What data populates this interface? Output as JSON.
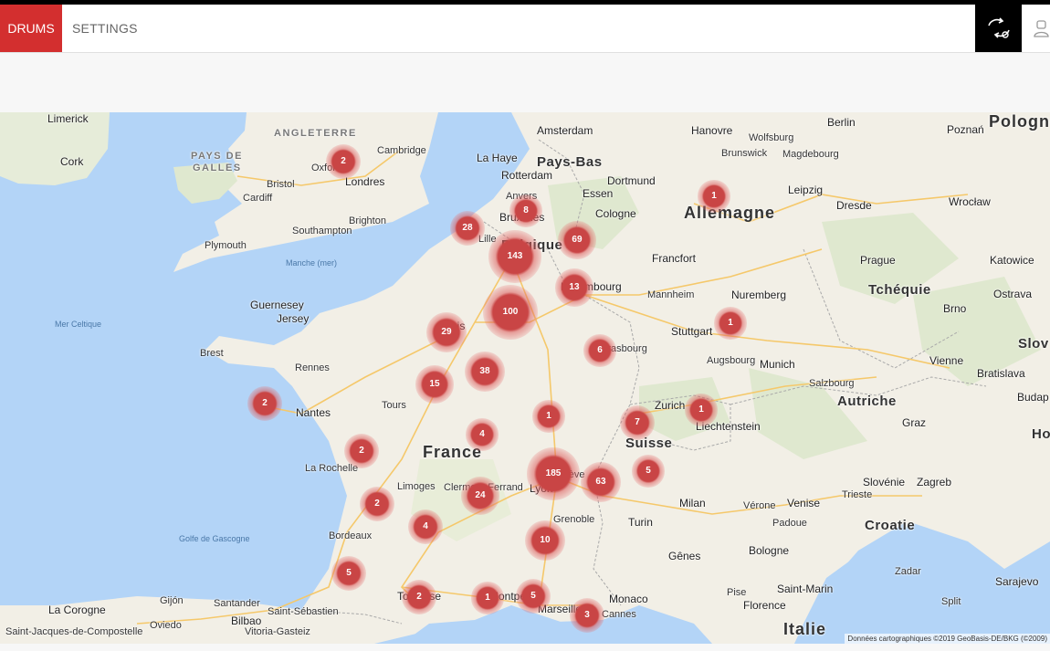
{
  "nav": {
    "drums_label": "DRUMS",
    "settings_label": "SETTINGS",
    "sync_icon": "sync-icon",
    "user_icon": "user-icon"
  },
  "colors": {
    "accent": "#d32f2f",
    "marker": "#c94545",
    "water": "#b3d4f7",
    "land": "#f2efe6"
  },
  "map": {
    "attribution": "Données cartographiques ©2019 GeoBasis-DE/BKG (©2009)",
    "labels": [
      {
        "text": "Limerick",
        "cls": "city"
      },
      {
        "text": "ANGLETERRE",
        "cls": "region"
      },
      {
        "text": "PAYS DE",
        "cls": "region"
      },
      {
        "text": "GALLES",
        "cls": "region"
      },
      {
        "text": "Cork",
        "cls": "city"
      },
      {
        "text": "Cambridge",
        "cls": ""
      },
      {
        "text": "Oxford",
        "cls": ""
      },
      {
        "text": "Londres",
        "cls": "city"
      },
      {
        "text": "Bristol",
        "cls": ""
      },
      {
        "text": "Cardiff",
        "cls": ""
      },
      {
        "text": "Brighton",
        "cls": ""
      },
      {
        "text": "Southampton",
        "cls": ""
      },
      {
        "text": "Plymouth",
        "cls": ""
      },
      {
        "text": "Manche (mer)",
        "cls": "sea"
      },
      {
        "text": "Mer Celtique",
        "cls": "sea"
      },
      {
        "text": "Guernesey",
        "cls": "city"
      },
      {
        "text": "Jersey",
        "cls": "city"
      },
      {
        "text": "Brest",
        "cls": ""
      },
      {
        "text": "Rennes",
        "cls": ""
      },
      {
        "text": "Nantes",
        "cls": "city"
      },
      {
        "text": "Tours",
        "cls": ""
      },
      {
        "text": "La Rochelle",
        "cls": ""
      },
      {
        "text": "Limoges",
        "cls": ""
      },
      {
        "text": "Bordeaux",
        "cls": ""
      },
      {
        "text": "Golfe de Gascogne",
        "cls": "sea"
      },
      {
        "text": "France",
        "cls": "big"
      },
      {
        "text": "Amsterdam",
        "cls": "city"
      },
      {
        "text": "La Haye",
        "cls": "city"
      },
      {
        "text": "Pays-Bas",
        "cls": "med"
      },
      {
        "text": "Rotterdam",
        "cls": "city"
      },
      {
        "text": "Anvers",
        "cls": ""
      },
      {
        "text": "Bruxelles",
        "cls": "city"
      },
      {
        "text": "Lille",
        "cls": ""
      },
      {
        "text": "Belgique",
        "cls": "med"
      },
      {
        "text": "Luxembourg",
        "cls": "city"
      },
      {
        "text": "Paris",
        "cls": "city"
      },
      {
        "text": "Strasbourg",
        "cls": ""
      },
      {
        "text": "Hanovre",
        "cls": "city"
      },
      {
        "text": "Wolfsburg",
        "cls": ""
      },
      {
        "text": "Brunswick",
        "cls": ""
      },
      {
        "text": "Magdebourg",
        "cls": ""
      },
      {
        "text": "Berlin",
        "cls": "city"
      },
      {
        "text": "Poznań",
        "cls": "city"
      },
      {
        "text": "Pologne",
        "cls": "big"
      },
      {
        "text": "Dortmund",
        "cls": "city"
      },
      {
        "text": "Essen",
        "cls": "city"
      },
      {
        "text": "Cologne",
        "cls": "city"
      },
      {
        "text": "Leipzig",
        "cls": "city"
      },
      {
        "text": "Dresde",
        "cls": "city"
      },
      {
        "text": "Wrocław",
        "cls": "city"
      },
      {
        "text": "Allemagne",
        "cls": "big"
      },
      {
        "text": "Francfort",
        "cls": "city"
      },
      {
        "text": "Prague",
        "cls": "city"
      },
      {
        "text": "Katowice",
        "cls": "city"
      },
      {
        "text": "Mannheim",
        "cls": ""
      },
      {
        "text": "Nuremberg",
        "cls": "city"
      },
      {
        "text": "Tchéquie",
        "cls": "med"
      },
      {
        "text": "Ostrava",
        "cls": "city"
      },
      {
        "text": "Brno",
        "cls": "city"
      },
      {
        "text": "Stuttgart",
        "cls": "city"
      },
      {
        "text": "Augsbourg",
        "cls": ""
      },
      {
        "text": "Munich",
        "cls": "city"
      },
      {
        "text": "Salzbourg",
        "cls": ""
      },
      {
        "text": "Vienne",
        "cls": "city"
      },
      {
        "text": "Bratislava",
        "cls": "city"
      },
      {
        "text": "Slov",
        "cls": "med"
      },
      {
        "text": "Autriche",
        "cls": "med"
      },
      {
        "text": "Budap",
        "cls": "city"
      },
      {
        "text": "Zurich",
        "cls": "city"
      },
      {
        "text": "Liechtenstein",
        "cls": "city"
      },
      {
        "text": "Graz",
        "cls": "city"
      },
      {
        "text": "Suisse",
        "cls": "med"
      },
      {
        "text": "Genève",
        "cls": ""
      },
      {
        "text": "Lyon",
        "cls": "city"
      },
      {
        "text": "Clermont-Ferrand",
        "cls": ""
      },
      {
        "text": "Grenoble",
        "cls": ""
      },
      {
        "text": "Slovénie",
        "cls": "city"
      },
      {
        "text": "Zagreb",
        "cls": "city"
      },
      {
        "text": "Ho",
        "cls": "med"
      },
      {
        "text": "Milan",
        "cls": "city"
      },
      {
        "text": "Vérone",
        "cls": ""
      },
      {
        "text": "Venise",
        "cls": "city"
      },
      {
        "text": "Trieste",
        "cls": ""
      },
      {
        "text": "Padoue",
        "cls": ""
      },
      {
        "text": "Turin",
        "cls": "city"
      },
      {
        "text": "Croatie",
        "cls": "med"
      },
      {
        "text": "Gênes",
        "cls": "city"
      },
      {
        "text": "Bologne",
        "cls": "city"
      },
      {
        "text": "Zadar",
        "cls": ""
      },
      {
        "text": "Saint-Marin",
        "cls": "city"
      },
      {
        "text": "Pise",
        "cls": ""
      },
      {
        "text": "Florence",
        "cls": "city"
      },
      {
        "text": "Sarajevo",
        "cls": "city"
      },
      {
        "text": "Split",
        "cls": ""
      },
      {
        "text": "Monaco",
        "cls": "city"
      },
      {
        "text": "Cannes",
        "cls": ""
      },
      {
        "text": "Marseille",
        "cls": "city"
      },
      {
        "text": "Montpellier",
        "cls": "city"
      },
      {
        "text": "Toulouse",
        "cls": "city"
      },
      {
        "text": "Italie",
        "cls": "big"
      },
      {
        "text": "La Corogne",
        "cls": "city"
      },
      {
        "text": "Gijón",
        "cls": ""
      },
      {
        "text": "Oviedo",
        "cls": ""
      },
      {
        "text": "Santander",
        "cls": ""
      },
      {
        "text": "Saint-Sébastien",
        "cls": ""
      },
      {
        "text": "Bilbao",
        "cls": "city"
      },
      {
        "text": "Vitoria-Gasteiz",
        "cls": ""
      },
      {
        "text": "Saint-Jacques-de-Compostelle",
        "cls": ""
      }
    ],
    "markers": [
      {
        "count": "2"
      },
      {
        "count": "8"
      },
      {
        "count": "28"
      },
      {
        "count": "69"
      },
      {
        "count": "143"
      },
      {
        "count": "13"
      },
      {
        "count": "100"
      },
      {
        "count": "29"
      },
      {
        "count": "6"
      },
      {
        "count": "38"
      },
      {
        "count": "15"
      },
      {
        "count": "2"
      },
      {
        "count": "1"
      },
      {
        "count": "4"
      },
      {
        "count": "2"
      },
      {
        "count": "185"
      },
      {
        "count": "63"
      },
      {
        "count": "24"
      },
      {
        "count": "2"
      },
      {
        "count": "4"
      },
      {
        "count": "10"
      },
      {
        "count": "5"
      },
      {
        "count": "2"
      },
      {
        "count": "1"
      },
      {
        "count": "5"
      },
      {
        "count": "3"
      },
      {
        "count": "7"
      },
      {
        "count": "5"
      },
      {
        "count": "1"
      },
      {
        "count": "1"
      },
      {
        "count": "1"
      }
    ]
  }
}
